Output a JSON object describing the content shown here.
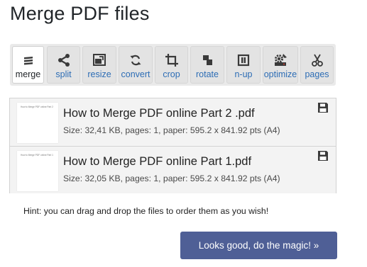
{
  "page": {
    "title": "Merge PDF files"
  },
  "toolbar": {
    "tools": [
      {
        "label": "merge",
        "icon": "merge-icon",
        "active": true
      },
      {
        "label": "split",
        "icon": "split-icon"
      },
      {
        "label": "resize",
        "icon": "resize-icon"
      },
      {
        "label": "convert",
        "icon": "convert-icon"
      },
      {
        "label": "crop",
        "icon": "crop-icon"
      },
      {
        "label": "rotate",
        "icon": "rotate-icon"
      },
      {
        "label": "n-up",
        "icon": "n-up-icon"
      },
      {
        "label": "optimize",
        "icon": "optimize-icon"
      },
      {
        "label": "pages",
        "icon": "pages-icon"
      }
    ]
  },
  "files": [
    {
      "name": "How to Merge PDF online Part 2 .pdf",
      "meta": "Size: 32,41 KB, pages: 1, paper: 595.2 x 841.92 pts (A4)",
      "thumb_text": "How to Merge PDF online Part 2"
    },
    {
      "name": "How to Merge PDF online Part 1.pdf",
      "meta": "Size: 32,05 KB, pages: 1, paper: 595.2 x 841.92 pts (A4)",
      "thumb_text": "How to Merge PDF online Part 1"
    }
  ],
  "hint": "Hint: you can drag and drop the files to order them as you wish!",
  "action": {
    "label": "Looks good, do the magic! »"
  },
  "colors": {
    "accent": "#4f5f96",
    "link": "#2d6db5",
    "icon": "#3a3a3a"
  }
}
